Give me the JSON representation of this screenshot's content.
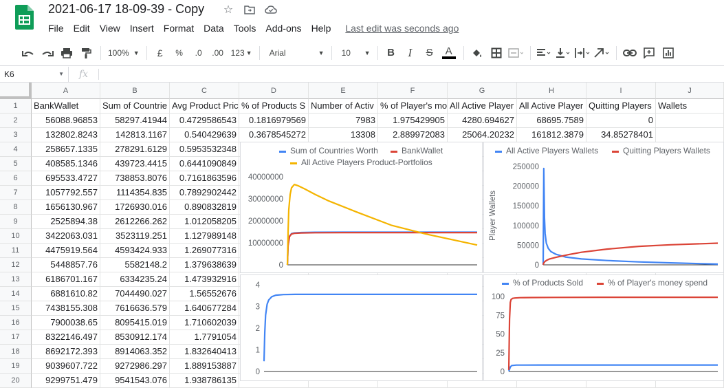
{
  "app": {
    "title": "2021-06-17 18-09-39 - Copy",
    "menus": [
      "File",
      "Edit",
      "View",
      "Insert",
      "Format",
      "Data",
      "Tools",
      "Add-ons",
      "Help"
    ],
    "last_edit": "Last edit was seconds ago"
  },
  "toolbar": {
    "zoom": "100%",
    "currency": "£",
    "percent": "%",
    "dec_less": ".0",
    "dec_more": ".00",
    "more_formats": "123",
    "font": "Arial",
    "font_size": "10",
    "bold": "B",
    "italic": "I",
    "strike": "S",
    "text_color": "A"
  },
  "formula_bar": {
    "cell_ref": "K6",
    "fx": "fx",
    "value": ""
  },
  "sheet": {
    "columns": [
      "A",
      "B",
      "C",
      "D",
      "E",
      "F",
      "G",
      "H",
      "I",
      "J"
    ],
    "row_numbers": [
      "1",
      "2",
      "3",
      "4",
      "5",
      "6",
      "7",
      "8",
      "9",
      "10",
      "11",
      "12",
      "13",
      "14",
      "15",
      "16",
      "17",
      "18",
      "19",
      "20"
    ],
    "header_row": [
      "BankWallet",
      "Sum of Countrie",
      "Avg Product Pric",
      "% of Products S",
      "Number of Activ",
      "% of Player's mo",
      "All Active Player",
      "All Active Player",
      "Quitting Players",
      "Wallets"
    ],
    "rows": [
      [
        "56088.96853",
        "58297.41944",
        "0.4729586543",
        "0.1816979569",
        "7983",
        "1.975429905",
        "4280.694627",
        "68695.7589",
        "0"
      ],
      [
        "132802.8243",
        "142813.1167",
        "0.540429639",
        "0.3678545272",
        "13308",
        "2.889972083",
        "25064.20232",
        "161812.3879",
        "34.85278401"
      ],
      [
        "258657.1335",
        "278291.6129",
        "0.5953532348"
      ],
      [
        "408585.1346",
        "439723.4415",
        "0.6441090849"
      ],
      [
        "695533.4727",
        "738853.8076",
        "0.7161863596"
      ],
      [
        "1057792.557",
        "1114354.835",
        "0.7892902442"
      ],
      [
        "1656130.967",
        "1726930.016",
        "0.890832819"
      ],
      [
        "2525894.38",
        "2612266.262",
        "1.012058205"
      ],
      [
        "3422063.031",
        "3523119.251",
        "1.127989148"
      ],
      [
        "4475919.564",
        "4593424.933",
        "1.269077316"
      ],
      [
        "5448857.76",
        "5582148.2",
        "1.379638639"
      ],
      [
        "6186701.167",
        "6334235.24",
        "1.473932916"
      ],
      [
        "6881610.82",
        "7044490.027",
        "1.56552676"
      ],
      [
        "7438155.308",
        "7616636.579",
        "1.640677284"
      ],
      [
        "7900038.65",
        "8095415.019",
        "1.710602039"
      ],
      [
        "8322146.497",
        "8530912.174",
        "1.7791054"
      ],
      [
        "8692172.393",
        "8914063.352",
        "1.832640413"
      ],
      [
        "9039607.722",
        "9272986.297",
        "1.889153887"
      ],
      [
        "9299751.479",
        "9541543.076",
        "1.938786135"
      ]
    ]
  },
  "colors": {
    "blue": "#4285f4",
    "red": "#db4437",
    "yellow": "#f4b400",
    "sheets_green": "#0f9d58"
  },
  "chart_data": [
    {
      "type": "line",
      "series": [
        {
          "name": "Sum of Countries Worth",
          "color": "#4285f4",
          "x": [
            0,
            1,
            3,
            6,
            10,
            20,
            40,
            80,
            150,
            274
          ],
          "y": [
            0,
            9000000,
            13000000,
            14200000,
            14500000,
            14700000,
            14800000,
            14850000,
            14850000,
            14850000
          ]
        },
        {
          "name": "BankWallet",
          "color": "#db4437",
          "x": [
            0,
            1,
            3,
            6,
            10,
            20,
            40,
            80,
            150,
            274
          ],
          "y": [
            0,
            8800000,
            12800000,
            14000000,
            14300000,
            14500000,
            14600000,
            14650000,
            14650000,
            14650000
          ]
        },
        {
          "name": "All Active Players Product-Portfolios",
          "color": "#f4b400",
          "x": [
            0,
            1,
            2,
            4,
            6,
            10,
            15,
            25,
            40,
            60,
            100,
            150,
            200,
            274
          ],
          "y": [
            0,
            15000000,
            25000000,
            32000000,
            35000000,
            36500000,
            36000000,
            34500000,
            32000000,
            29000000,
            24000000,
            18000000,
            14000000,
            9000000
          ]
        }
      ],
      "yticks": [
        "0",
        "10000000",
        "20000000",
        "30000000",
        "40000000"
      ],
      "ylim": [
        0,
        40000000
      ]
    },
    {
      "type": "line",
      "series": [
        {
          "name": "All Active Players Wallets",
          "color": "#4285f4",
          "x": [
            0,
            1,
            2,
            3,
            5,
            8,
            12,
            20,
            35,
            60,
            100,
            150,
            200,
            274
          ],
          "y": [
            0,
            245000,
            120000,
            80000,
            55000,
            42000,
            34000,
            27000,
            20000,
            15000,
            11000,
            7500,
            5000,
            2000
          ]
        },
        {
          "name": "Quitting Players Wallets",
          "color": "#db4437",
          "x": [
            0,
            1,
            3,
            6,
            10,
            20,
            40,
            60,
            100,
            150,
            200,
            274
          ],
          "y": [
            0,
            5000,
            9000,
            12000,
            15000,
            19000,
            26000,
            32000,
            40000,
            47000,
            51000,
            55000
          ]
        }
      ],
      "ylabel": "Player Wallets",
      "yticks": [
        "0",
        "50000",
        "100000",
        "150000",
        "200000",
        "250000"
      ],
      "ylim": [
        0,
        250000
      ]
    },
    {
      "type": "line",
      "series": [
        {
          "color": "#4285f4",
          "x": [
            0,
            1,
            2,
            4,
            6,
            10,
            15,
            25,
            40,
            80,
            150,
            274
          ],
          "y": [
            0.47,
            1.8,
            2.6,
            3.1,
            3.3,
            3.45,
            3.52,
            3.55,
            3.56,
            3.56,
            3.56,
            3.56
          ]
        }
      ],
      "yticks": [
        "0",
        "1",
        "2",
        "3",
        "4"
      ],
      "ylim": [
        0,
        4
      ]
    },
    {
      "type": "line",
      "series": [
        {
          "name": "% of Products Sold",
          "color": "#4285f4",
          "x": [
            0,
            1,
            2,
            4,
            10,
            40,
            100,
            274
          ],
          "y": [
            0.18,
            3,
            6,
            8,
            8.5,
            8.6,
            8.6,
            8.6
          ]
        },
        {
          "name": "% of Player's money spend",
          "color": "#db4437",
          "x": [
            0,
            1,
            2,
            3,
            5,
            8,
            15,
            30,
            60,
            120,
            274
          ],
          "y": [
            1.97,
            70,
            92,
            96,
            97.5,
            98,
            98.4,
            98.6,
            98.8,
            99,
            99
          ]
        }
      ],
      "yticks": [
        "0",
        "25",
        "50",
        "75",
        "100"
      ],
      "ylim": [
        0,
        100
      ]
    }
  ]
}
